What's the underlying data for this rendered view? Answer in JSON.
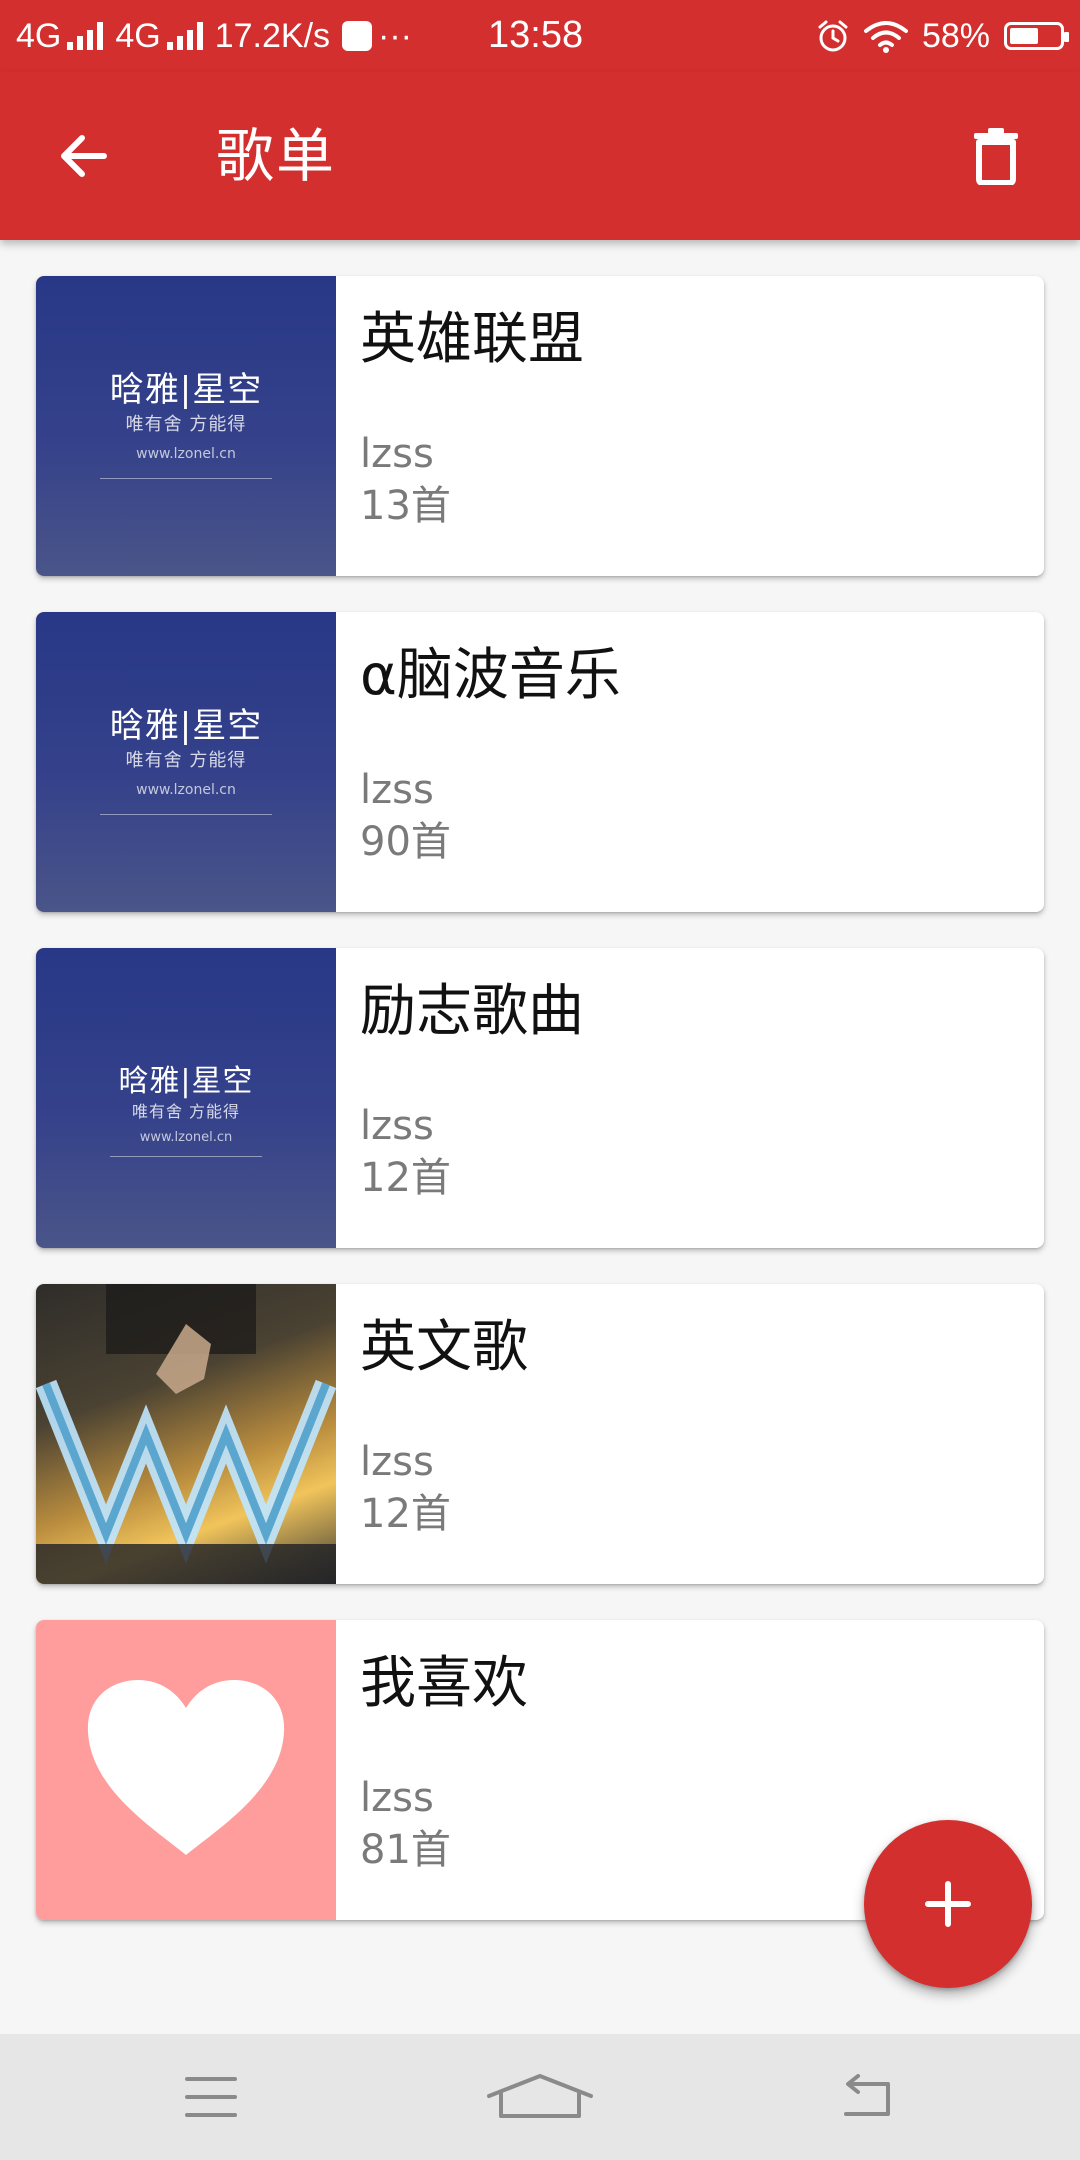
{
  "status_bar": {
    "network_1": "4G",
    "network_2": "4G",
    "speed": "17.2K/s",
    "more": "···",
    "time": "13:58",
    "battery_text": "58%",
    "battery_level": 0.58
  },
  "app_bar": {
    "title": "歌单",
    "back_icon": "arrow-left-icon",
    "delete_icon": "trash-icon"
  },
  "playlists": [
    {
      "name": "英雄联盟",
      "owner": "lzss",
      "count": "13首",
      "cover": "blue-text",
      "cover_text": {
        "title": "晗雅|星空",
        "subtitle": "唯有舍 方能得",
        "url": "www.lzonel.cn"
      }
    },
    {
      "name": "α脑波音乐",
      "owner": "lzss",
      "count": "90首",
      "cover": "blue-text",
      "cover_text": {
        "title": "晗雅|星空",
        "subtitle": "唯有舍 方能得",
        "url": "www.lzonel.cn"
      }
    },
    {
      "name": "励志歌曲",
      "owner": "lzss",
      "count": "12首",
      "cover": "blue-text",
      "cover_text": {
        "title": "晗雅|星空",
        "subtitle": "唯有舍 方能得",
        "url": "www.lzonel.cn"
      }
    },
    {
      "name": "英文歌",
      "owner": "lzss",
      "count": "12首",
      "cover": "album-art"
    },
    {
      "name": "我喜欢",
      "owner": "lzss",
      "count": "81首",
      "cover": "heart"
    }
  ],
  "fab": {
    "icon": "plus-icon"
  },
  "nav_bar": {
    "menu_icon": "menu-icon",
    "home_icon": "home-icon",
    "back_icon": "return-icon"
  },
  "colors": {
    "primary": "#d32f2f",
    "cover_blue": "#2c3a86",
    "heart_bg": "#ff9c9c",
    "secondary_text": "#7a7a7a"
  }
}
